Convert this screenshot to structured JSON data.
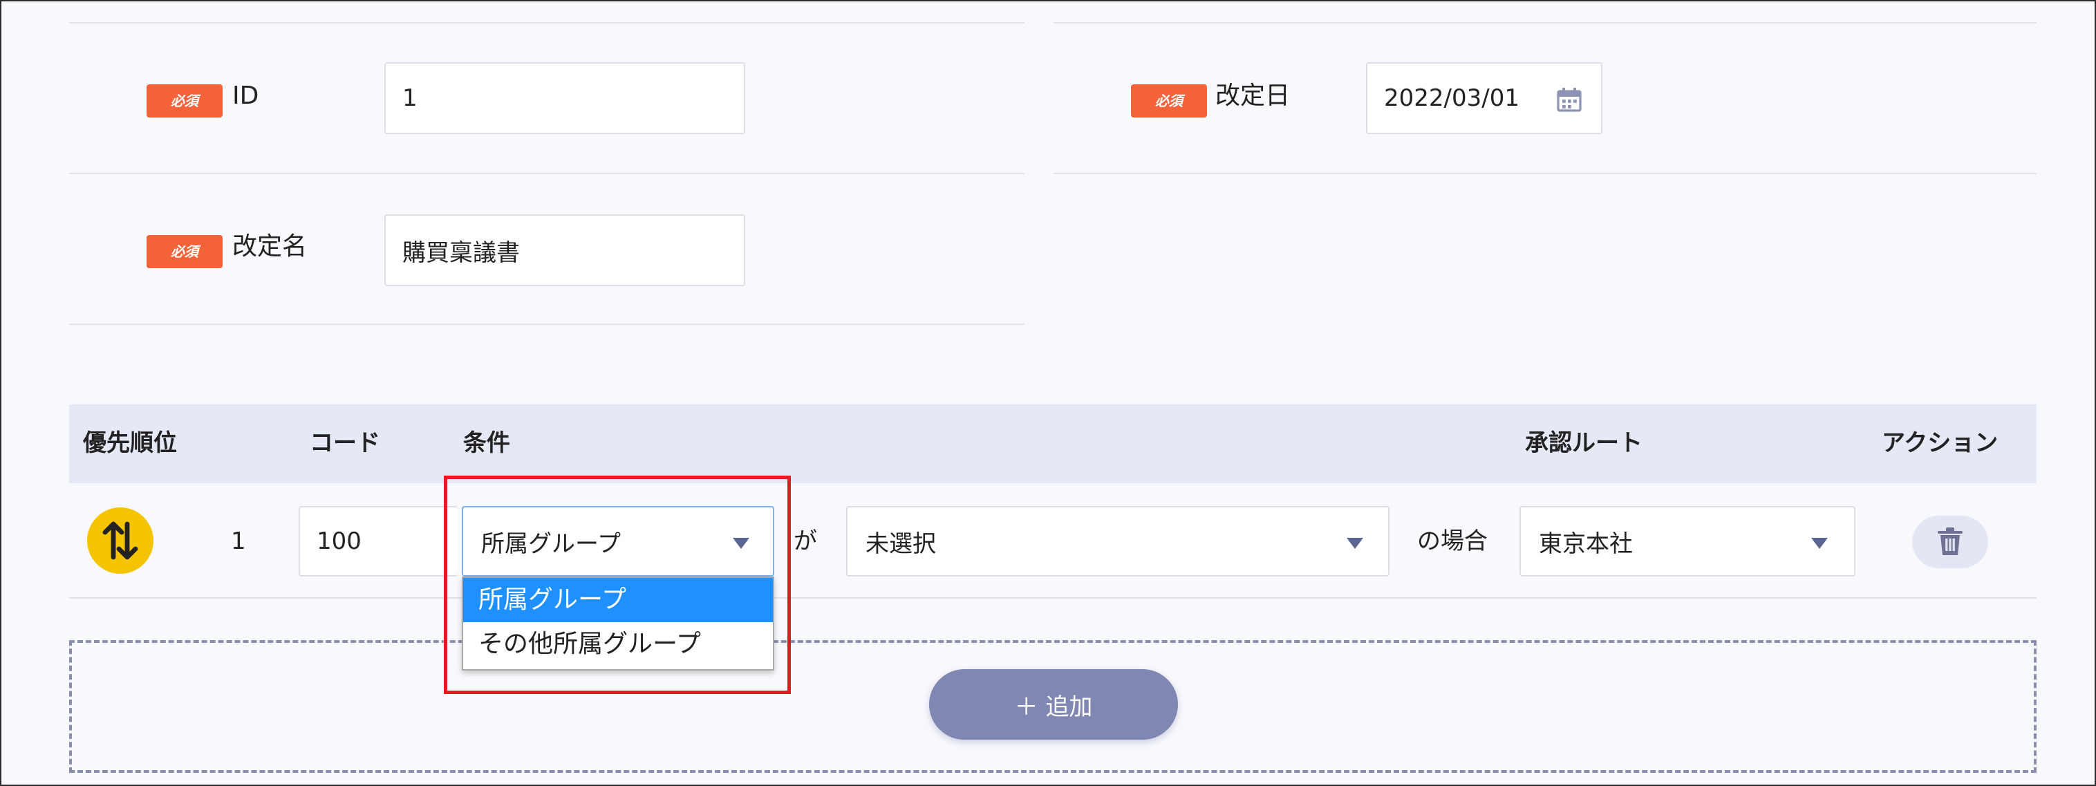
{
  "form": {
    "required_badge": "必須",
    "id_label": "ID",
    "id_value": "1",
    "revision_date_label": "改定日",
    "revision_date_value": "2022/03/01",
    "revision_name_label": "改定名",
    "revision_name_value": "購買稟議書"
  },
  "table": {
    "headers": {
      "priority": "優先順位",
      "code": "コード",
      "condition": "条件",
      "route": "承認ルート",
      "action": "アクション"
    },
    "row": {
      "priority": "1",
      "code": "100",
      "condition_field": "所属グループ",
      "particle_ga": "が",
      "condition_value": "未選択",
      "particle_case": "の場合",
      "route": "東京本社"
    },
    "dropdown_options": [
      "所属グループ",
      "その他所属グループ"
    ],
    "add_button": "＋ 追加"
  },
  "colors": {
    "badge": "#f4623a",
    "header_bg": "#e5e8f5",
    "option_selected": "#1e90ff",
    "highlight": "#e11d22",
    "add_button": "#7f87b2",
    "sort_icon": "#f5c400"
  }
}
